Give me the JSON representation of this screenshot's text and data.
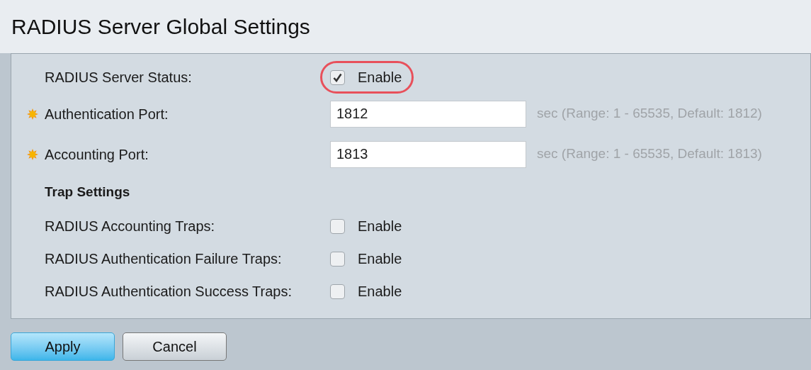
{
  "title": "RADIUS Server Global Settings",
  "rows": [
    {
      "kind": "checkbox",
      "label": "RADIUS Server Status:",
      "required": false,
      "checked": true,
      "option": "Enable",
      "highlighted": true
    },
    {
      "kind": "field",
      "label": "Authentication Port:",
      "required": true,
      "value": "1812",
      "hint": "sec (Range: 1 - 65535, Default: 1812)"
    },
    {
      "kind": "field",
      "label": "Accounting Port:",
      "required": true,
      "value": "1813",
      "hint": "sec (Range: 1 - 65535, Default: 1813)"
    },
    {
      "kind": "heading",
      "label": "Trap Settings"
    },
    {
      "kind": "checkbox",
      "label": "RADIUS Accounting Traps:",
      "required": false,
      "checked": false,
      "option": "Enable",
      "highlighted": false
    },
    {
      "kind": "checkbox",
      "label": "RADIUS Authentication Failure Traps:",
      "required": false,
      "checked": false,
      "option": "Enable",
      "highlighted": false
    },
    {
      "kind": "checkbox",
      "label": "RADIUS Authentication Success Traps:",
      "required": false,
      "checked": false,
      "option": "Enable",
      "highlighted": false
    }
  ],
  "buttons": [
    {
      "label": "Apply",
      "primary": true
    },
    {
      "label": "Cancel",
      "primary": false
    }
  ]
}
